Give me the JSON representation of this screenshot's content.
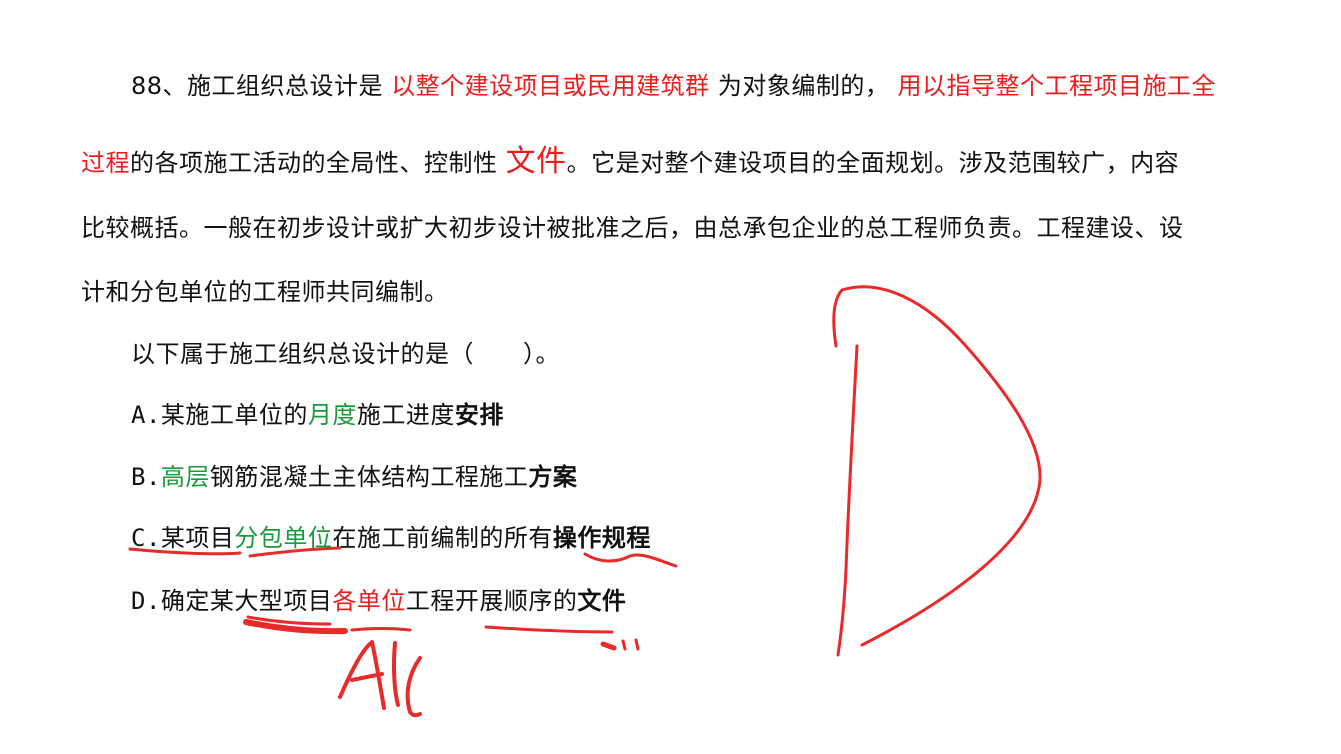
{
  "question": {
    "number": "88、",
    "p1_a": "施工组织总设计是",
    "p1_red1": "以整个建设项目或民用建筑群",
    "p1_b": "为对象编制的，",
    "p1_red2": "用以指导整个工程项目施工全",
    "p2_red": "过程",
    "p2_a": "的各项施工活动的全局性、控制性",
    "p2_red_big": "文件",
    "p2_b": "。它是对整个建设项目的全面规划。涉及范围较广，内容",
    "p3": "比较概括。一般在初步设计或扩大初步设计被批准之后，由总承包企业的总工程师负责。工程建设、设",
    "p4": "计和分包单位的工程师共同编制。",
    "prompt": "以下属于施工组织总设计的是（　　）。"
  },
  "options": {
    "a": {
      "letter": "A.",
      "t1": "某施工单位的",
      "green": "月度",
      "t2": "施工进度",
      "bold": "安排"
    },
    "b": {
      "letter": "B.",
      "green": "高层",
      "t1": "钢筋混凝土主体结构工程施工",
      "bold": "方案"
    },
    "c": {
      "letter": "C.",
      "t1": "某项目",
      "green": "分包单位",
      "t2": "在施工前编制的所有",
      "bold": "操作规程"
    },
    "d": {
      "letter": "D.",
      "t1": "确定某大型项目",
      "red": "各单位",
      "t2": "工程开展顺序的",
      "bold": "文件"
    }
  },
  "annotations": {
    "answer_letter": "D",
    "note": "All",
    "ink_color": "#e82a2a"
  },
  "colors": {
    "red": "#ee1c1c",
    "green": "#1a9a3a",
    "text": "#111111"
  }
}
